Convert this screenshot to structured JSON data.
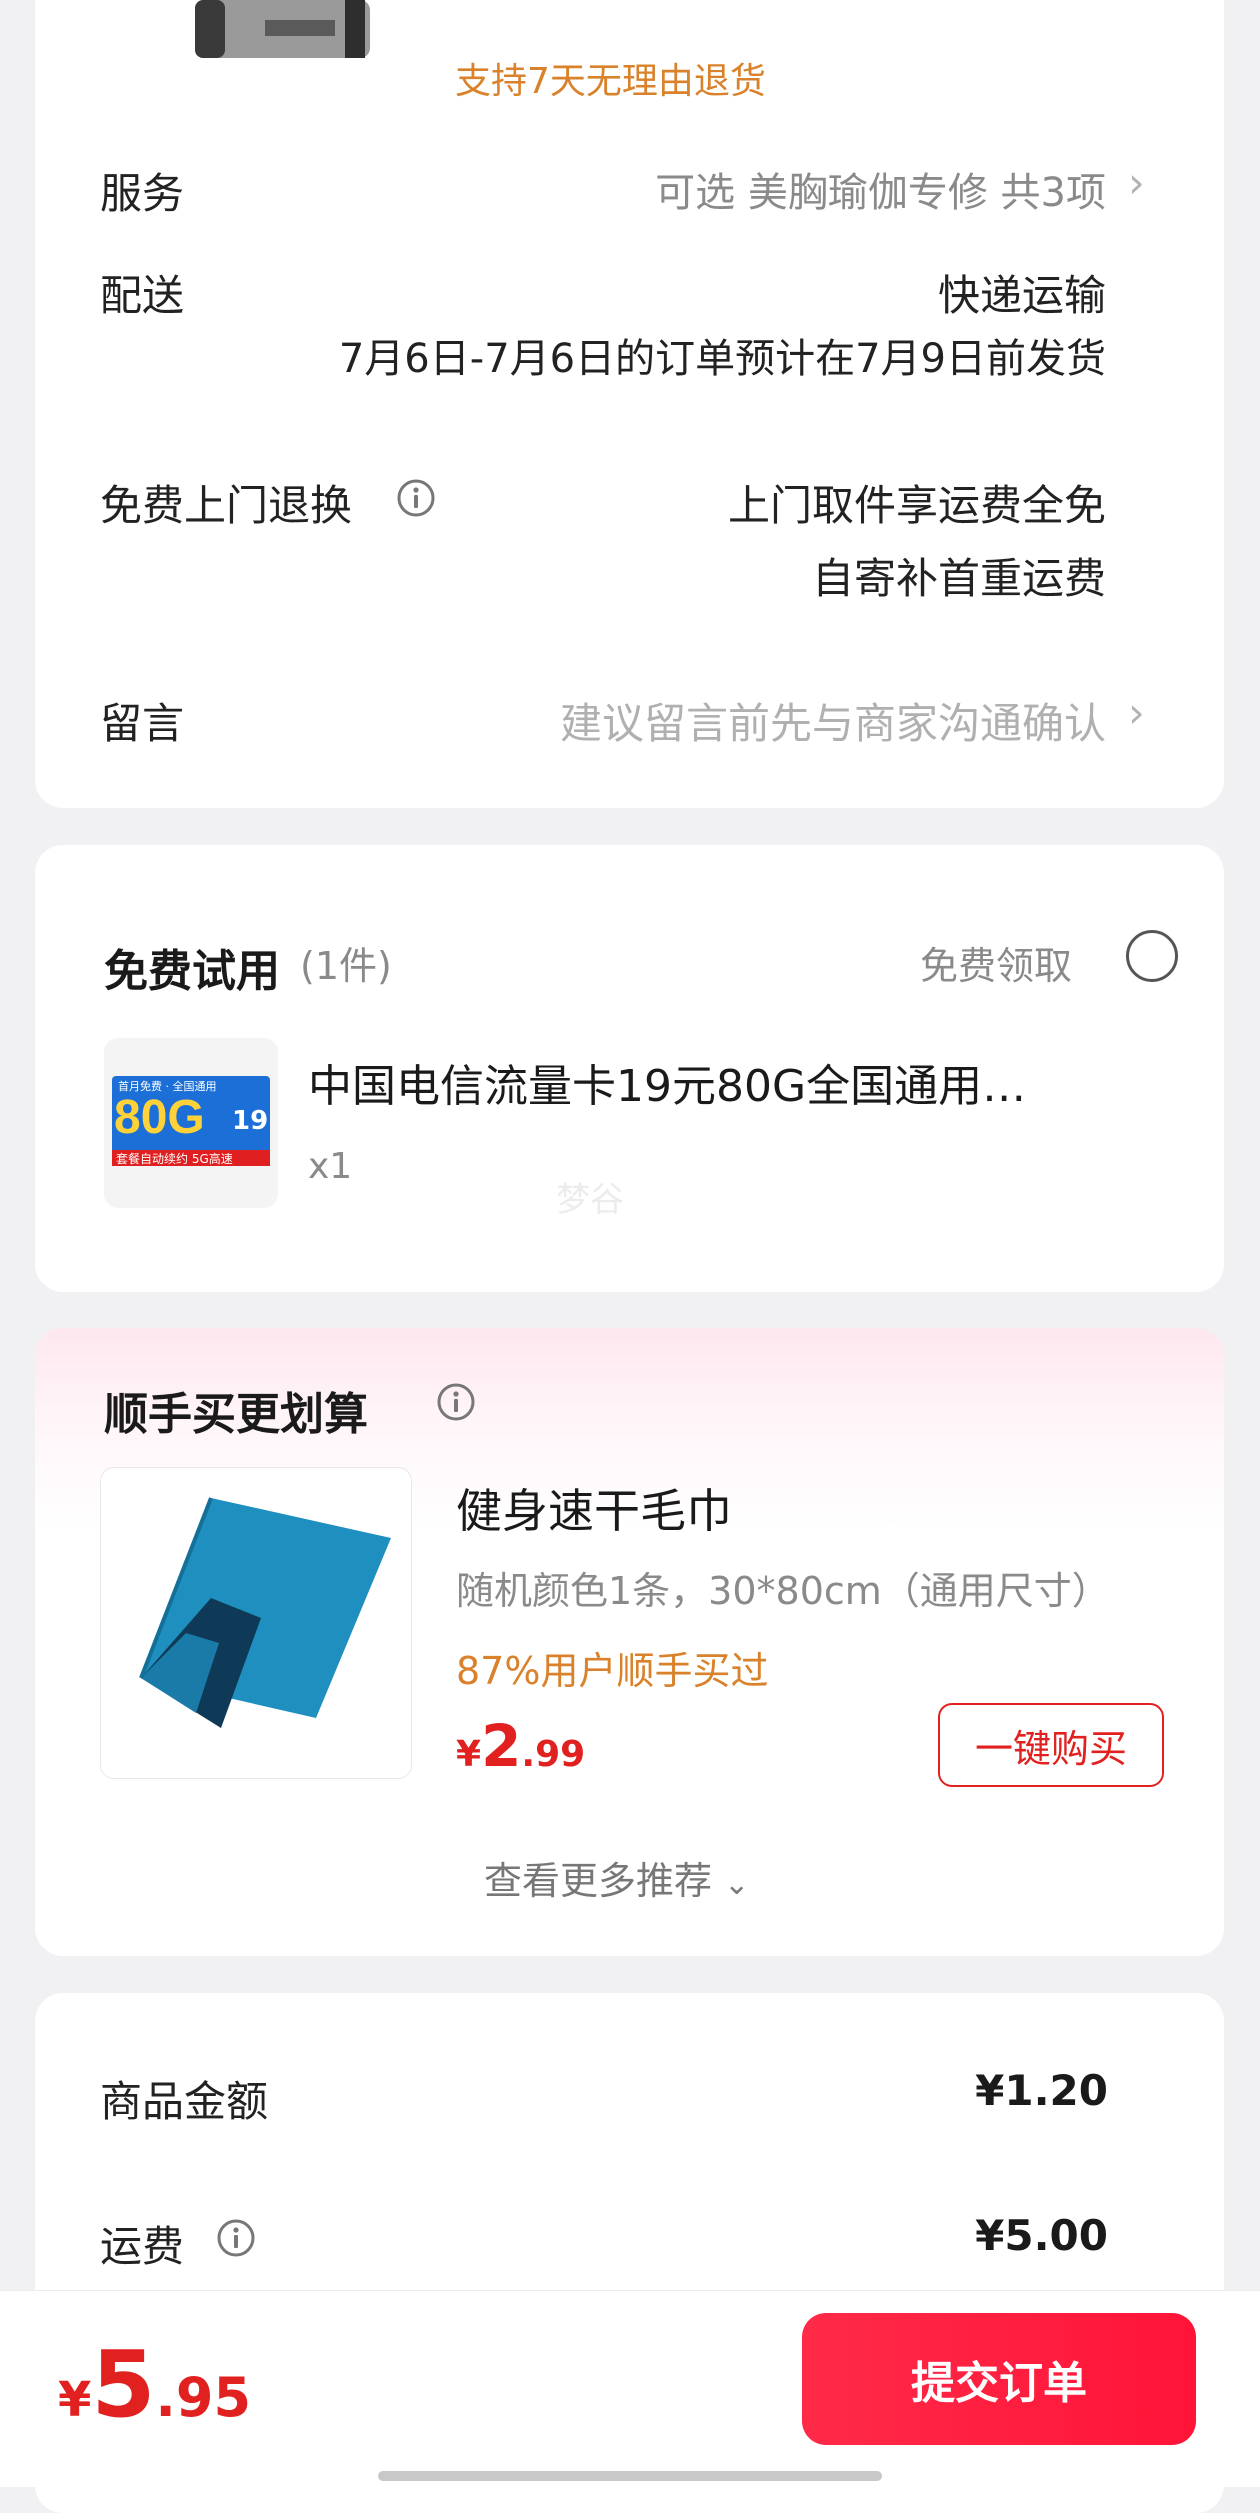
{
  "product": {
    "return_policy": "支持7天无理由退货"
  },
  "order_rows": {
    "service": {
      "label": "服务",
      "value": "可选 美胸瑜伽专修 共3项"
    },
    "delivery": {
      "label": "配送",
      "method": "快递运输",
      "estimate": "7月6日-7月6日的订单预计在7月9日前发货"
    },
    "free_return": {
      "label": "免费上门退换",
      "line1": "上门取件享运费全免",
      "line2": "自寄补首重运费"
    },
    "message": {
      "label": "留言",
      "placeholder": "建议留言前先与商家沟通确认"
    }
  },
  "free_trial": {
    "title": "免费试用",
    "count": "(1件)",
    "claim_label": "免费领取",
    "item": {
      "name": "中国电信流量卡19元80G全国通用…",
      "qty": "x1",
      "thumb_text": "80G",
      "thumb_price": "19",
      "thumb_caption": "套餐自动续约 5G高速",
      "thumb_header": "首月免费 · 全国通用"
    },
    "watermark": "梦谷"
  },
  "addon": {
    "title": "顺手买更划算",
    "item": {
      "name": "健身速干毛巾",
      "spec": "随机颜色1条，30*80cm（通用尺寸）",
      "social": "87%用户顺手买过",
      "currency": "¥",
      "price_int": "2",
      "price_dec": ".99",
      "buy_label": "一键购买"
    },
    "more_label": "查看更多推荐"
  },
  "summary": {
    "goods": {
      "label": "商品金额",
      "value": "¥1.20"
    },
    "shipping": {
      "label": "运费",
      "value": "¥5.00"
    }
  },
  "bottom": {
    "currency": "¥",
    "total_int": "5",
    "total_dec": ".95",
    "submit_label": "提交订单"
  },
  "colors": {
    "accent": "#ff1f3f",
    "price_red": "#e0211f",
    "orange": "#d9822b"
  }
}
